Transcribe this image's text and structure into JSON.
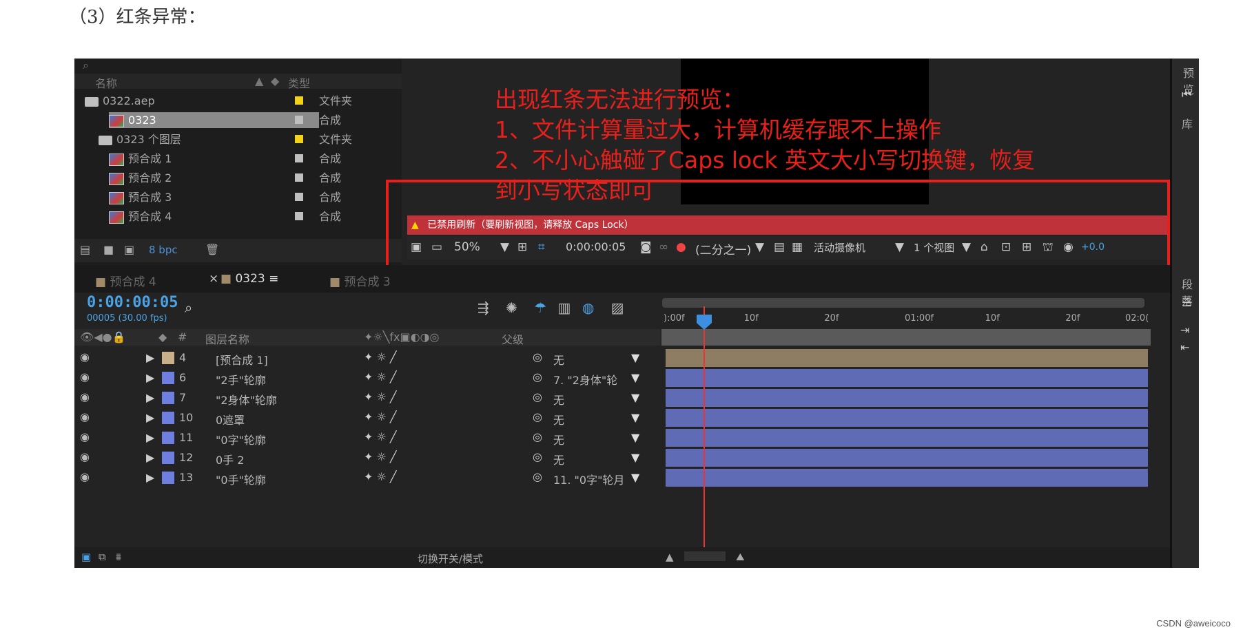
{
  "doc": {
    "heading": "（3）红条异常：",
    "watermark": "CSDN @aweicoco"
  },
  "project": {
    "cols": {
      "name": "名称",
      "type": "类型"
    },
    "items": [
      {
        "name": "0322.aep",
        "type": "文件夹",
        "kind": "folder",
        "color": "#f2d21b"
      },
      {
        "name": "0323",
        "type": "合成",
        "kind": "comp",
        "color": "#bfbfbf",
        "selected": true
      },
      {
        "name": "0323 个图层",
        "type": "文件夹",
        "kind": "folder",
        "color": "#f2d21b"
      },
      {
        "name": "预合成 1",
        "type": "合成",
        "kind": "comp",
        "color": "#bfbfbf"
      },
      {
        "name": "预合成 2",
        "type": "合成",
        "kind": "comp",
        "color": "#bfbfbf"
      },
      {
        "name": "预合成 3",
        "type": "合成",
        "kind": "comp",
        "color": "#bfbfbf"
      },
      {
        "name": "预合成 4",
        "type": "合成",
        "kind": "comp",
        "color": "#bfbfbf"
      }
    ],
    "bpc": "8 bpc"
  },
  "viewer": {
    "warning": "已禁用刷新（要刷新视图，请释放 Caps Lock）",
    "zoom": "50%",
    "time": "0:00:00:05",
    "resolution": "(二分之一)",
    "camera": "活动摄像机",
    "views": "1 个视图",
    "offset": "+0.0"
  },
  "annotation": {
    "text": "出现红条无法进行预览：\n1、文件计算量过大，计算机缓存跟不上操作\n2、不小心触碰了Caps lock 英文大小写切换键，恢复\n到小写状态即可"
  },
  "right_strip": {
    "preview": "预览",
    "library": "库",
    "paragraph": "段落"
  },
  "tabs": [
    {
      "label": "预合成 4",
      "active": false
    },
    {
      "label": "0323",
      "active": true
    },
    {
      "label": "预合成 3",
      "active": false
    }
  ],
  "timeline": {
    "timecode": "0:00:00:05",
    "fps": "00005 (30.00 fps)",
    "col_layer_name": "图层名称",
    "col_parent": "父级",
    "ruler": [
      "):00f",
      "10f",
      "20f",
      "01:00f",
      "10f",
      "20f",
      "02:0("
    ],
    "layers": [
      {
        "num": "4",
        "name": "[预合成 1]",
        "parent": "无",
        "color": "#c8b08a"
      },
      {
        "num": "6",
        "name": "\"2手\"轮廓",
        "parent": "7. \"2身体\"轮",
        "color": "#6f7fe0"
      },
      {
        "num": "7",
        "name": "\"2身体\"轮廓",
        "parent": "无",
        "color": "#6f7fe0"
      },
      {
        "num": "10",
        "name": "0遮罩",
        "parent": "无",
        "color": "#6f7fe0"
      },
      {
        "num": "11",
        "name": "\"0字\"轮廓",
        "parent": "无",
        "color": "#6f7fe0"
      },
      {
        "num": "12",
        "name": "0手 2",
        "parent": "无",
        "color": "#6f7fe0"
      },
      {
        "num": "13",
        "name": "\"0手\"轮廓",
        "parent": "11. \"0字\"轮月",
        "color": "#6f7fe0"
      }
    ],
    "toggle_label": "切换开关/模式"
  }
}
